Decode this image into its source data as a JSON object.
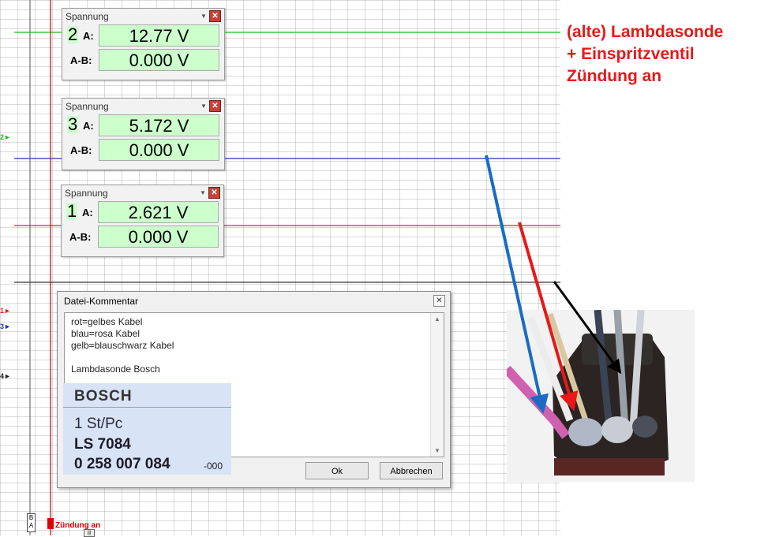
{
  "colors": {
    "channel1": "#e02020",
    "channel2": "#22bb22",
    "channel3": "#2233aa",
    "channel4": "#222222",
    "meter_value_bg": "#ccffcc",
    "annotation": "#e8181a"
  },
  "channel_markers": [
    {
      "text": "2►",
      "color": "#22bb22"
    },
    {
      "text": "1►",
      "color": "#e02020"
    },
    {
      "text": "3►",
      "color": "#2233aa"
    },
    {
      "text": "4►",
      "color": "#222222"
    }
  ],
  "meters": [
    {
      "title": "Spannung",
      "channel": "2",
      "a_label": "A:",
      "a_value": "12.77 V",
      "ab_label": "A-B:",
      "ab_value": "0.000 V",
      "close": "✕",
      "dropdown": "▼"
    },
    {
      "title": "Spannung",
      "channel": "3",
      "a_label": "A:",
      "a_value": "5.172 V",
      "ab_label": "A-B:",
      "ab_value": "0.000 V",
      "close": "✕",
      "dropdown": "▼"
    },
    {
      "title": "Spannung",
      "channel": "1",
      "a_label": "A:",
      "a_value": "2.621 V",
      "ab_label": "A-B:",
      "ab_value": "0.000 V",
      "close": "✕",
      "dropdown": "▼"
    }
  ],
  "dialog": {
    "title": "Datei-Kommentar",
    "close": "✕",
    "lines": [
      "rot=gelbes Kabel",
      "blau=rosa Kabel",
      "gelb=blauschwarz Kabel",
      "",
      "Lambdasonde Bosch"
    ],
    "ok_label": "Ok",
    "cancel_label": "Abbrechen",
    "scroll_up": "▲",
    "scroll_down": "▼"
  },
  "photo_label": {
    "brand": "BOSCH",
    "qty": "1 St/Pc",
    "model": "LS 7084",
    "part_number": "0 258 007 084",
    "suffix": "-000"
  },
  "annotation": {
    "line1": "(alte) Lambdasonde",
    "line2": "+ Einspritzventil",
    "line3": "Zündung an"
  },
  "trigger": {
    "label": "Zündung an"
  },
  "cursor_box": {
    "top": "B",
    "bottom": "A"
  },
  "scroll_handle": "|||"
}
